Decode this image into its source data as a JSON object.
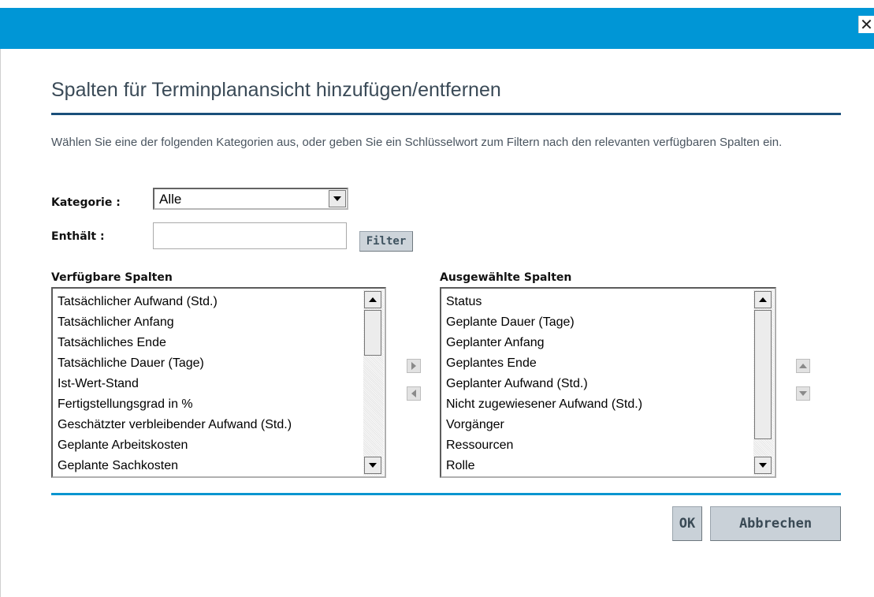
{
  "window": {
    "close_glyph": "✕",
    "titlebar_color": "#0096d6"
  },
  "dialog": {
    "title": "Spalten für Terminplanansicht hinzufügen/entfernen",
    "instructions": "Wählen Sie eine der folgenden Kategorien aus, oder geben Sie ein Schlüsselwort zum Filtern nach den relevanten verfügbaren Spalten ein."
  },
  "filters": {
    "category_label": "Kategorie :",
    "category_value": "Alle",
    "contains_label": "Enthält :",
    "contains_value": "",
    "filter_button": "Filter"
  },
  "available": {
    "heading": "Verfügbare Spalten",
    "items": [
      "Tatsächlicher Aufwand (Std.)",
      "Tatsächlicher Anfang",
      "Tatsächliches Ende",
      "Tatsächliche Dauer (Tage)",
      "Ist-Wert-Stand",
      "Fertigstellungsgrad in %",
      "Geschätzter verbleibender Aufwand (Std.)",
      "Geplante Arbeitskosten",
      "Geplante Sachkosten"
    ]
  },
  "selected": {
    "heading": "Ausgewählte Spalten",
    "items": [
      "Status",
      "Geplante Dauer (Tage)",
      "Geplanter Anfang",
      "Geplantes Ende",
      "Geplanter Aufwand (Std.)",
      "Nicht zugewiesener Aufwand (Std.)",
      "Vorgänger",
      "Ressourcen",
      "Rolle"
    ]
  },
  "icons": {
    "move_right": "arrow-right-icon",
    "move_left": "arrow-left-icon",
    "move_up": "arrow-up-icon",
    "move_down": "arrow-down-icon"
  },
  "buttons": {
    "ok": "OK",
    "cancel": "Abbrechen"
  }
}
